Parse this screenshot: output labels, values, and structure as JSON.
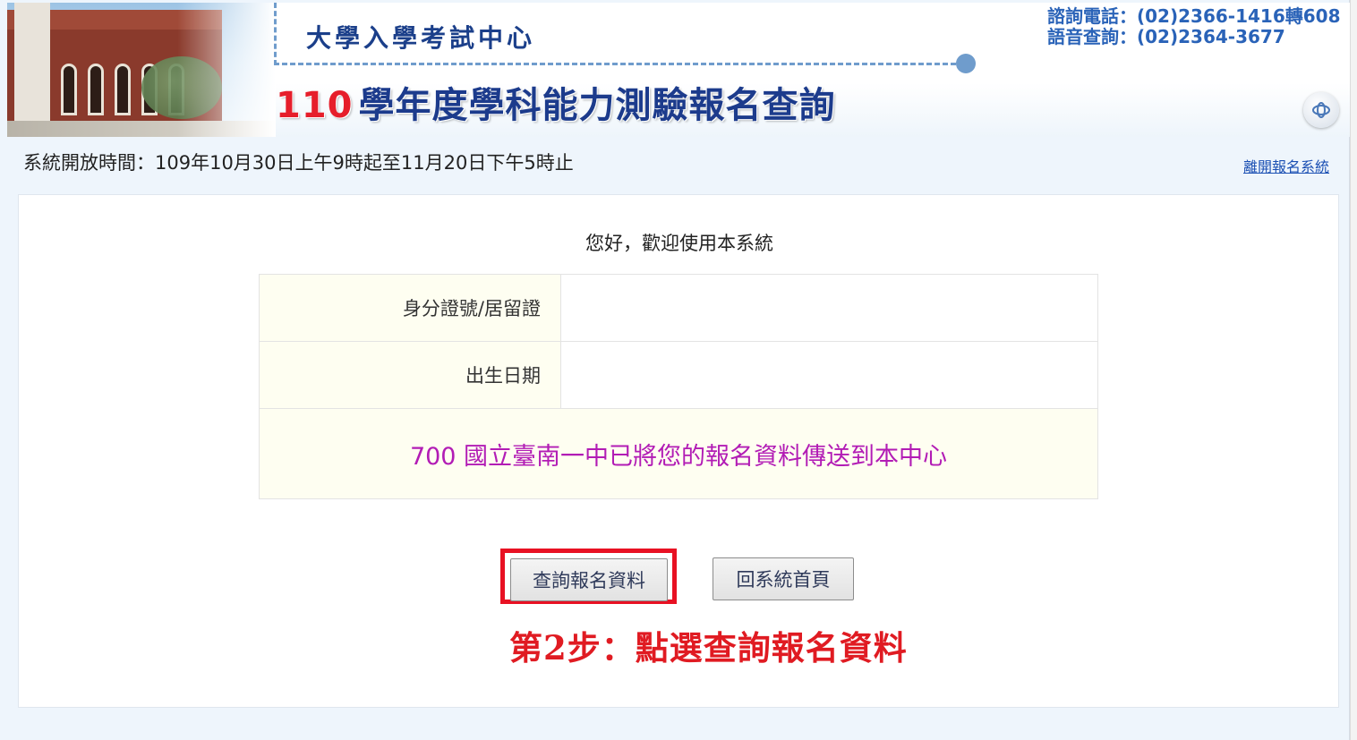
{
  "header": {
    "center_name": "大學入學考試中心",
    "title_year": "110",
    "title_rest": "學年度學科能力測驗報名查詢",
    "contact_phone": "諮詢電話：(02)2366-1416轉608",
    "contact_voice": "語音查詢：(02)2364-3677",
    "contact_icon": "network-icon"
  },
  "info_bar": {
    "open_time": "系統開放時間：109年10月30日上午9時起至11月20日下午5時止",
    "exit_link": "離開報名系統"
  },
  "main": {
    "welcome": "您好，歡迎使用本系統",
    "rows": [
      {
        "label": "身分證號/居留證",
        "value": ""
      },
      {
        "label": "出生日期",
        "value": ""
      }
    ],
    "notice": "700 國立臺南一中已將您的報名資料傳送到本中心",
    "buttons": {
      "query": "查詢報名資料",
      "home": "回系統首頁"
    },
    "step_note": "第2步：點選查詢報名資料"
  },
  "colors": {
    "title_year": "#e61e2b",
    "title": "#1c3b8c",
    "notice": "#b21cb5",
    "highlight": "#e81123",
    "step_note": "#e01b22",
    "link": "#1a4fb3"
  }
}
